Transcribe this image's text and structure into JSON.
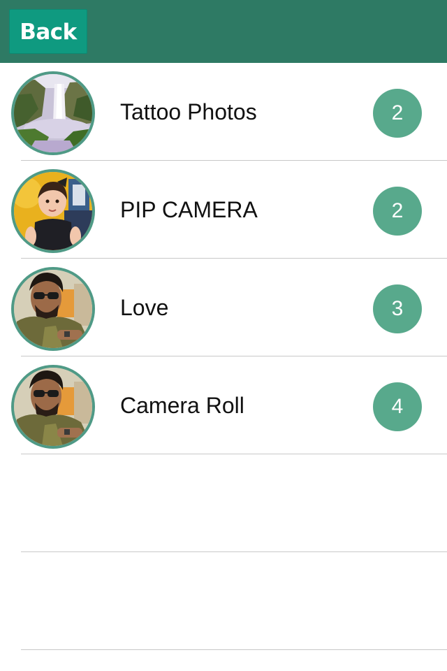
{
  "header": {
    "back_label": "Back",
    "background_color": "#2e7a64",
    "button_color": "#0f9a80"
  },
  "albums": [
    {
      "name": "Tattoo Photos",
      "count": "2",
      "thumbnail": "waterfall-photo"
    },
    {
      "name": "PIP CAMERA",
      "count": "2",
      "thumbnail": "baby-photo"
    },
    {
      "name": "Love",
      "count": "3",
      "thumbnail": "man-with-sunglasses-photo"
    },
    {
      "name": "Camera Roll",
      "count": "4",
      "thumbnail": "man-with-sunglasses-photo"
    }
  ],
  "colors": {
    "badge": "#58a98c",
    "avatar_border": "#4f9a86",
    "divider": "#c8c8c8"
  }
}
